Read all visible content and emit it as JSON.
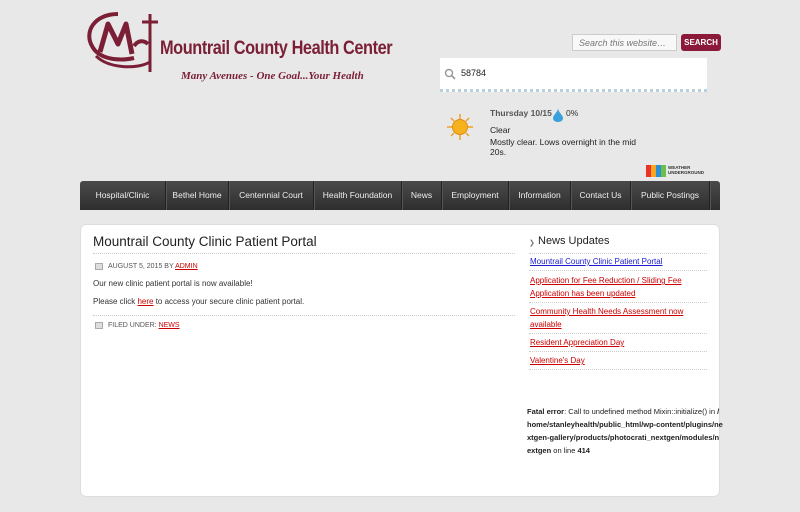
{
  "logo": {
    "name": "Mountrail County Health Center",
    "tagline": "Many Avenues - One Goal...Your Health"
  },
  "search": {
    "placeholder": "Search this website…",
    "button_label": "SEARCH"
  },
  "weather": {
    "zip": "58784",
    "day": "Thursday 10/15",
    "precip": "0%",
    "condition": "Clear",
    "description": "Mostly clear. Lows overnight in the mid 20s.",
    "provider_line1": "WEATHER",
    "provider_line2": "UNDERGROUND"
  },
  "nav": {
    "items": [
      {
        "label": "Hospital/Clinic"
      },
      {
        "label": "Bethel Home"
      },
      {
        "label": "Centennial Court"
      },
      {
        "label": "Health Foundation"
      },
      {
        "label": "News"
      },
      {
        "label": "Employment"
      },
      {
        "label": "Information"
      },
      {
        "label": "Contact Us"
      },
      {
        "label": "Public Postings"
      }
    ]
  },
  "post": {
    "title": "Mountrail County Clinic Patient Portal",
    "date": "AUGUST 5, 2015",
    "by": "BY",
    "author": "ADMIN",
    "body1": "Our new clinic patient portal is now available!",
    "body2_pre": "Please click ",
    "body2_link": "here",
    "body2_post": " to access your secure clinic patient portal.",
    "filed_label": "FILED UNDER:",
    "category": "NEWS"
  },
  "sidebar": {
    "title": "News Updates",
    "links": [
      {
        "label": "Mountrail County Clinic Patient Portal"
      },
      {
        "label": "Application for Fee Reduction / Sliding Fee Application has been updated"
      },
      {
        "label": "Community Health Needs Assessment now available"
      },
      {
        "label": "Resident Appreciation Day"
      },
      {
        "label": "Valentine's Day"
      }
    ]
  },
  "error": {
    "label": "Fatal error",
    "message": ": Call to undefined method Mixin::initialize() in ",
    "path": "/home/stanleyhealth/public_html/wp-content/plugins/nextgen-gallery/products/photocrati_nextgen/modules/nextgen",
    "line_label": " on line ",
    "line": "414"
  }
}
